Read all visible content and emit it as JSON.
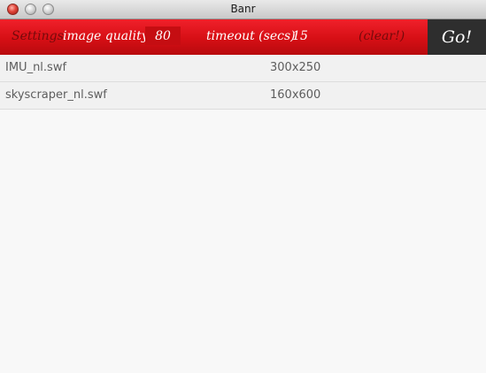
{
  "window": {
    "title": "Banr"
  },
  "toolbar": {
    "settings_label": "Settings",
    "quality_label": "image quality",
    "quality_value": "80",
    "timeout_label": "timeout (secs)",
    "timeout_value": "15",
    "clear_label": "(clear!)",
    "go_label": "Go!"
  },
  "files": [
    {
      "name": "IMU_nl.swf",
      "size": "300x250"
    },
    {
      "name": "skyscraper_nl.swf",
      "size": "160x600"
    }
  ],
  "colors": {
    "toolbar_red": "#d60f15",
    "go_button_bg": "#2e2e2e",
    "muted_label": "#750a0b"
  }
}
